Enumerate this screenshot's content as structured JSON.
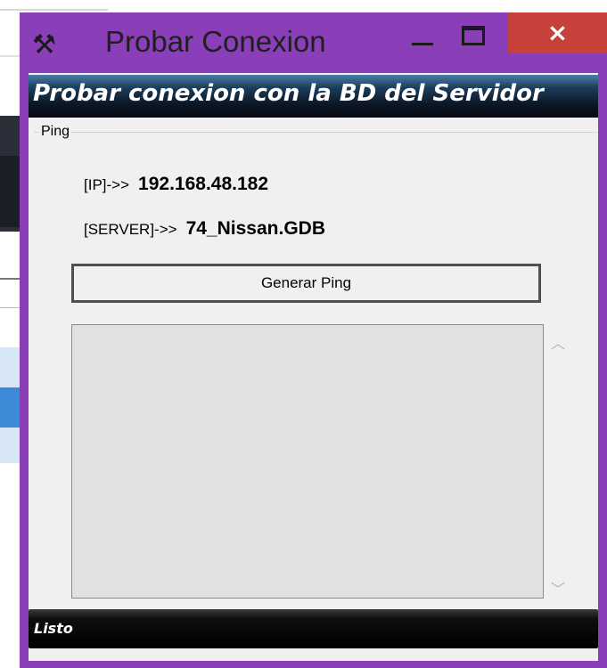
{
  "window": {
    "title": "Probar Conexion",
    "icon": "tools-icon",
    "close_glyph": "×"
  },
  "header": {
    "title": "Probar conexion con la BD del Servidor"
  },
  "ping_group": {
    "label": "Ping",
    "ip_label": "[IP]->>",
    "ip_value": "192.168.48.182",
    "server_label": "[SERVER]->>",
    "server_value": "74_Nissan.GDB"
  },
  "actions": {
    "generate_label": "Generar Ping"
  },
  "output": {
    "value": ""
  },
  "status": {
    "text": "Listo"
  },
  "colors": {
    "window_border": "#8a3fb8",
    "close_button": "#c7403a",
    "client_bg": "#f0f0f0"
  }
}
